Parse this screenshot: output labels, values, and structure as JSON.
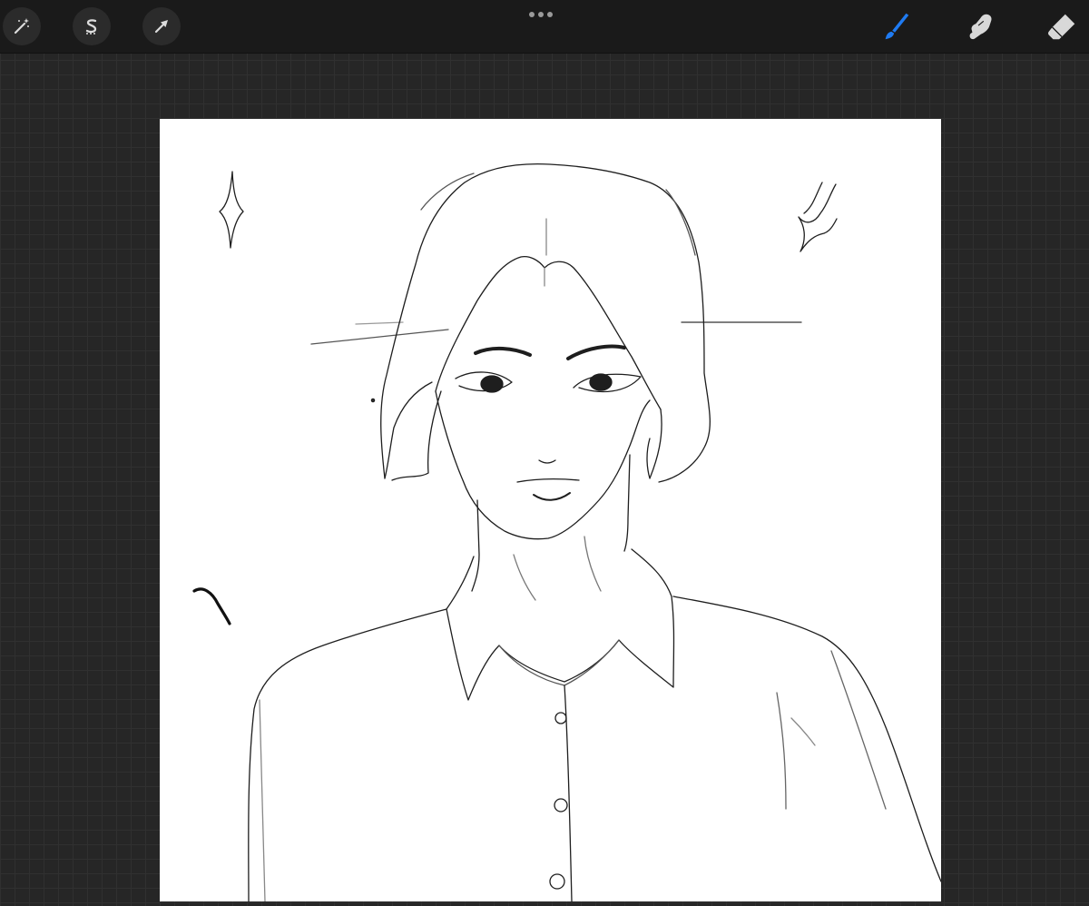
{
  "app": {
    "name": ""
  },
  "toolbar_left": [
    {
      "id": "adjustments",
      "icon": "magic-wand-icon"
    },
    {
      "id": "selection",
      "icon": "selection-s-icon"
    },
    {
      "id": "transform",
      "icon": "arrow-cursor-icon"
    }
  ],
  "toolbar_center": {
    "icon": "more-dots-icon"
  },
  "toolbar_right": [
    {
      "id": "paint",
      "icon": "brush-icon",
      "active": true
    },
    {
      "id": "smudge",
      "icon": "smudge-finger-icon",
      "active": false
    },
    {
      "id": "erase",
      "icon": "eraser-icon",
      "active": false
    }
  ],
  "colors": {
    "topbar": "#1a1a1a",
    "workspace": "#262626",
    "grid": "#303030",
    "active_tool": "#1f7bf2",
    "inactive_tool": "#d8d8d8",
    "canvas": "#ffffff",
    "ink": "#1a1a1a"
  },
  "canvas": {
    "subject": ""
  }
}
